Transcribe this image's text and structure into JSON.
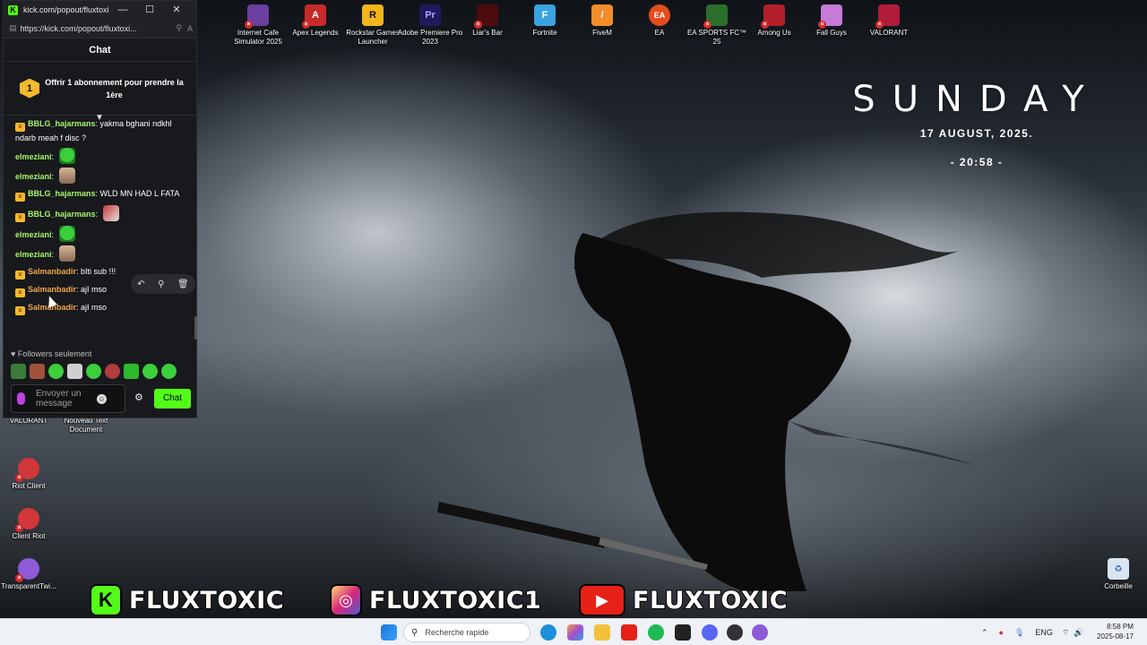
{
  "window": {
    "title": "kick.com/popout/fluxtoxic/...",
    "url": "https://kick.com/popout/fluxtoxi...",
    "chat_header": "Chat",
    "sub_promo": {
      "badge": "1",
      "text": "Offrir 1 abonnement pour prendre la 1ère"
    }
  },
  "messages": [
    {
      "user": "BBLG_hajarmans",
      "color": "orange-crown-green",
      "text": "yakma bghani ndkhl ndarb meah f disc ?",
      "badge": true,
      "emote": ""
    },
    {
      "user": "elmeziani",
      "text": "",
      "badge": false,
      "emote": "green"
    },
    {
      "user": "elmeziani",
      "text": "",
      "badge": false,
      "emote": "face"
    },
    {
      "user": "BBLG_hajarmans",
      "text": "WLD MN HAD L FATA",
      "badge": true,
      "emote": ""
    },
    {
      "user": "BBLG_hajarmans",
      "text": "",
      "badge": true,
      "emote": "red"
    },
    {
      "user": "elmeziani",
      "text": "",
      "badge": false,
      "emote": "green"
    },
    {
      "user": "elmeziani",
      "text": "",
      "badge": false,
      "emote": "face"
    },
    {
      "user": "Salmanbadir",
      "text": "bIti sub !!!",
      "badge": true,
      "emote": ""
    },
    {
      "user": "Salmanbadir",
      "text": "ajI mso",
      "badge": true,
      "emote": ""
    },
    {
      "user": "Salmanbadir",
      "text": "ajI mso",
      "badge": true,
      "emote": ""
    }
  ],
  "chat_footer": {
    "followers_label": "Followers seulement",
    "input_placeholder": "Envoyer un message",
    "send_label": "Chat"
  },
  "desktop_icons_top": [
    {
      "label": "Internet Cafe Simulator 2025",
      "color": "#6a3fa0"
    },
    {
      "label": "Apex Legends",
      "color": "#c72a2a"
    },
    {
      "label": "Rockstar Games Launcher",
      "color": "#f2b51c"
    },
    {
      "label": "Adobe Premiere Pro 2023",
      "color": "#1f1a5c"
    },
    {
      "label": "Liar's Bar",
      "color": "#4b0d0d"
    },
    {
      "label": "Fortnite",
      "color": "#3aa3e0"
    },
    {
      "label": "FiveM",
      "color": "#f28d2a"
    },
    {
      "label": "EA",
      "color": "#e54b1d"
    },
    {
      "label": "EA SPORTS FC™ 25",
      "color": "#2b6e2b"
    },
    {
      "label": "Among Us",
      "color": "#b3202a"
    },
    {
      "label": "Fall Guys",
      "color": "#c77ad8"
    },
    {
      "label": "VALORANT",
      "color": "#b01c3a"
    }
  ],
  "desktop_icons_left": [
    {
      "label": "VALORANT"
    },
    {
      "label": "Nouveau Text Document"
    },
    {
      "label": "Riot Client"
    },
    {
      "label": "Client Riot"
    },
    {
      "label": "TransparentTwi..."
    }
  ],
  "recycle_bin": "Corbeille",
  "clock": {
    "day": "SUNDAY",
    "date": "17 AUGUST, 2025.",
    "time": "- 20:58 -"
  },
  "social": {
    "kick": "FLUXTOXIC",
    "instagram": "FLUXTOXIC1",
    "youtube": "FLUXTOXIC"
  },
  "taskbar": {
    "search_placeholder": "Recherche rapide",
    "lang": "ENG",
    "time": "8:58 PM",
    "date": "2025-08-17"
  }
}
